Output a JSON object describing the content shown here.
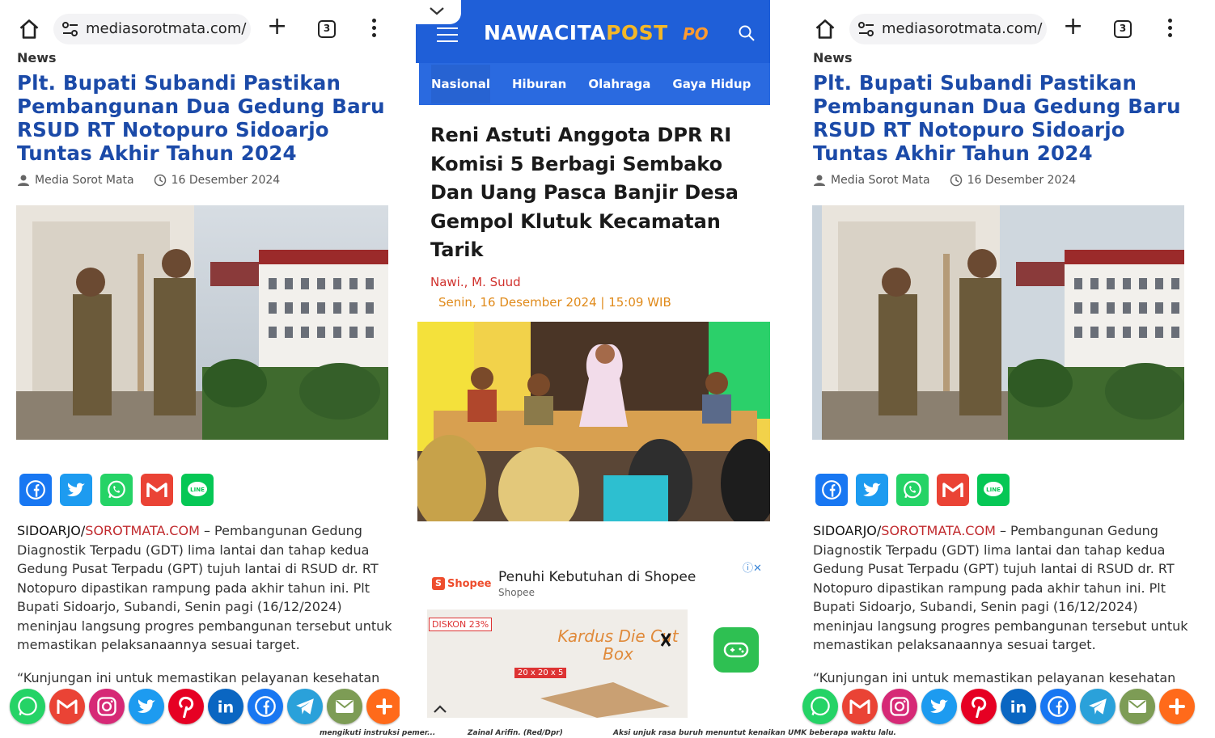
{
  "browser": {
    "url": "mediasorotmata.com/",
    "tab_count": "3"
  },
  "article": {
    "category": "News",
    "headline": "Plt. Bupati Subandi Pastikan Pembangunan Dua Gedung Baru RSUD RT Notopuro Sidoarjo Tuntas Akhir Tahun 2024",
    "author": "Media Sorot Mata",
    "date": "16 Desember 2024",
    "body_location": "SIDOARJO/",
    "body_brand": "SOROTMATA.COM",
    "body_text": " – Pembangunan Gedung Diagnostik Terpadu (GDT) lima lantai dan tahap kedua Gedung Pusat Terpadu (GPT) tujuh lantai di RSUD dr. RT Notopuro dipastikan rampung pada akhir tahun ini. Plt Bupati Sidoarjo, Subandi, Senin pagi (16/12/2024) meninjau langsung progres pembangunan tersebut untuk memastikan pelaksanaannya sesuai target.",
    "quote": "“Kunjungan ini untuk memastikan pelayanan kesehatan"
  },
  "share_buttons": [
    "facebook-icon",
    "twitter-icon",
    "whatsapp-icon",
    "gmail-icon",
    "line-icon"
  ],
  "float_share": [
    "whatsapp-icon",
    "gmail-icon",
    "instagram-icon",
    "twitter-icon",
    "pinterest-icon",
    "linkedin-icon",
    "facebook-icon",
    "telegram-icon",
    "email-icon",
    "more-icon"
  ],
  "colors": {
    "headline": "#1b4aa8",
    "brand_red": "#c0282c",
    "nav_blue": "#1f5fd8",
    "date_orange": "#e08a1a"
  },
  "nawacita": {
    "logo_main": "NAWACITA",
    "logo_accent": "POST",
    "logo_tv": "PO",
    "nav": [
      "Nasional",
      "Hiburan",
      "Olahraga",
      "Gaya Hidup"
    ],
    "title": "Reni Astuti Anggota DPR RI Komisi 5 Berbagi Sembako Dan Uang Pasca Banjir Desa Gempol Klutuk Kecamatan Tarik",
    "authors": "Nawi., M. Suud",
    "date": "Senin, 16 Desember 2024 | 15:09 WIB"
  },
  "ad": {
    "brand": "Shopee",
    "title": "Penuhi Kebutuhan di Shopee",
    "subtitle": "Shopee",
    "discount": "DISKON 23%",
    "product": "Kardus Die Cut Box",
    "size": "20 x 20 x 5"
  },
  "bottom_strip": {
    "left": "mengikuti instruksi pemer...",
    "mid": "Zainal Arifin. (Red/Dpr)",
    "right": "Aksi unjuk rasa buruh menuntut kenaikan UMK beberapa waktu lalu."
  }
}
